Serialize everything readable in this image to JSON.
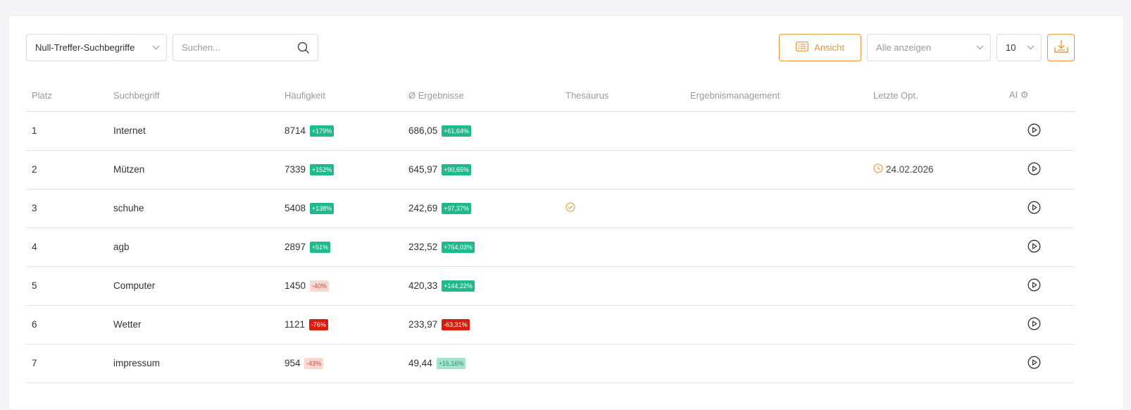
{
  "toolbar": {
    "type_select": {
      "value": "Null-Treffer-Suchbegriffe"
    },
    "search": {
      "placeholder": "Suchen..."
    },
    "view_button": {
      "label": "Ansicht"
    },
    "filter_select": {
      "value": "Alle anzeigen"
    },
    "page_size_select": {
      "value": "10"
    }
  },
  "table": {
    "headers": [
      "Platz",
      "Suchbegriff",
      "Häufigkeit",
      "Ø Ergebnisse",
      "Thesaurus",
      "Ergebnismanagement",
      "Letzte Opt.",
      "AI ⚙"
    ],
    "rows": [
      {
        "rank": "1",
        "term": "Internet",
        "frequency": "8714",
        "frequency_change": "+179%",
        "results": "686,05",
        "results_change": "+61,64%",
        "thesaurus": false,
        "last_opt": ""
      },
      {
        "rank": "2",
        "term": "Mützen",
        "frequency": "7339",
        "frequency_change": "+152%",
        "results": "645,97",
        "results_change": "+90,65%",
        "thesaurus": false,
        "last_opt": "24.02.2026"
      },
      {
        "rank": "3",
        "term": "schuhe",
        "frequency": "5408",
        "frequency_change": "+138%",
        "results": "242,69",
        "results_change": "+97,37%",
        "thesaurus": true,
        "last_opt": ""
      },
      {
        "rank": "4",
        "term": "agb",
        "frequency": "2897",
        "frequency_change": "+51%",
        "results": "232,52",
        "results_change": "+764,03%",
        "thesaurus": false,
        "last_opt": ""
      },
      {
        "rank": "5",
        "term": "Computer",
        "frequency": "1450",
        "frequency_change": "-40%",
        "results": "420,33",
        "results_change": "+144,22%",
        "thesaurus": false,
        "last_opt": ""
      },
      {
        "rank": "6",
        "term": "Wetter",
        "frequency": "1121",
        "frequency_change": "-76%",
        "results": "233,97",
        "results_change": "-63,31%",
        "thesaurus": false,
        "last_opt": ""
      },
      {
        "rank": "7",
        "term": "impressum",
        "frequency": "954",
        "frequency_change": "-43%",
        "results": "49,44",
        "results_change": "+16,16%",
        "thesaurus": false,
        "last_opt": ""
      }
    ]
  },
  "colors": {
    "accent": "#e8963a",
    "badge_up": "#1fb98b",
    "badge_up_light": "#a6e3cf",
    "badge_down_strong": "#d71e0c",
    "badge_down_light": "#fbd7d1"
  },
  "icons": {
    "search": "search-icon",
    "view": "list-icon",
    "download": "download-icon",
    "chevron": "chevron-down-icon",
    "thesaurus": "check-circle-icon",
    "last_opt": "clock-icon",
    "ai": "play-circle-icon"
  }
}
